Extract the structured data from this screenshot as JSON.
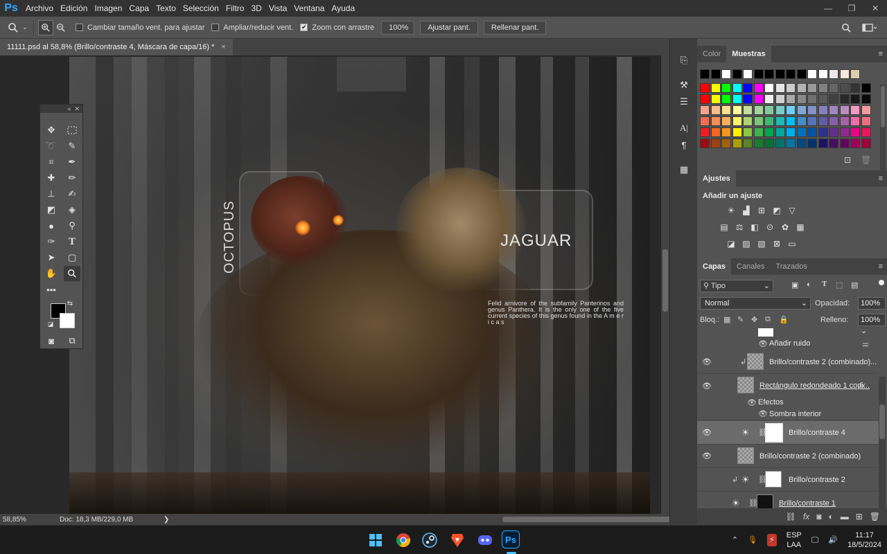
{
  "app": {
    "logo": "Ps"
  },
  "menu": [
    "Archivo",
    "Edición",
    "Imagen",
    "Capa",
    "Texto",
    "Selección",
    "Filtro",
    "3D",
    "Vista",
    "Ventana",
    "Ayuda"
  ],
  "window_controls": [
    "—",
    "❐",
    "✕"
  ],
  "options": {
    "resize_window": "Cambiar tamaño vent. para ajustar",
    "zoom_all": "Ampliar/reducir vent.",
    "scrubby_zoom": "Zoom con arrastre",
    "scrubby_zoom_checked": true,
    "zoom_value": "100%",
    "fit_screen": "Ajustar pant.",
    "fill_screen": "Rellenar pant."
  },
  "document": {
    "tab_title": "11111.psd al 58,8% (Brillo/contraste 4, Máscara de capa/16) *",
    "tab_close": "×"
  },
  "artwork": {
    "octopus_label": "OCTOPUS",
    "jaguar_label": "JAGUAR",
    "description": "Felid arnivore of the subfamily Panterinos and genus Panthera. It is the only one of the five current species of this genus found in the A m e r i c a s"
  },
  "status": {
    "zoom": "58,85%",
    "doc": "Doc: 18,3 MB/229,0 MB",
    "arrow": "❯"
  },
  "color_panel": {
    "tabs": [
      "Color",
      "Muestras"
    ],
    "active": "Muestras"
  },
  "swatch_colors": {
    "row1": [
      "#000000",
      "#000000",
      "#ffffff",
      "#000000",
      "#ffffff",
      "#000000",
      "#000000",
      "#000000",
      "#000000",
      "#000000",
      "#ffffff",
      "#ffffff",
      "#e8e8e8",
      "#f7e9d7",
      "#e0cdb0"
    ],
    "row2": [
      "#ff0000",
      "#ffff00",
      "#00ff00",
      "#00ffff",
      "#0000ff",
      "#ff00ff",
      "#ffffff",
      "#e6e6e6",
      "#cccccc",
      "#b3b3b3",
      "#999999",
      "#808080",
      "#666666",
      "#4d4d4d",
      "#333333",
      "#000000"
    ],
    "row3": [
      "#ff0000",
      "#ffff00",
      "#00ff00",
      "#00ffff",
      "#0000ff",
      "#ff00ff",
      "#f0f0f0",
      "#d0d0d0",
      "#a8a8a8",
      "#888888",
      "#707070",
      "#585858",
      "#404040",
      "#282828",
      "#181818",
      "#0a0a0a"
    ],
    "row4": [
      "#f7a38a",
      "#f9c08e",
      "#fde08e",
      "#fffb99",
      "#c4df9b",
      "#a3d39c",
      "#82ca9c",
      "#7accc8",
      "#6dcff6",
      "#7da7d9",
      "#8393ca",
      "#8781bd",
      "#a186be",
      "#bd8cbf",
      "#f49ac1",
      "#f5989d"
    ],
    "row5": [
      "#f26c4f",
      "#f68e55",
      "#fbaf5c",
      "#fff467",
      "#acd372",
      "#7cc576",
      "#3bb878",
      "#1abbb4",
      "#00bff3",
      "#438ccb",
      "#5574b9",
      "#605ca9",
      "#855fa8",
      "#a763a9",
      "#ef6ea8",
      "#f16d7e"
    ],
    "row6": [
      "#ed1c24",
      "#f26522",
      "#f7941d",
      "#fff200",
      "#8dc63f",
      "#39b54a",
      "#00a651",
      "#00a99d",
      "#00aeef",
      "#0072bc",
      "#0054a5",
      "#2e3192",
      "#662d91",
      "#92278f",
      "#ec008c",
      "#ed145b"
    ],
    "row7": [
      "#9e0b0f",
      "#a0410d",
      "#a3620a",
      "#aba000",
      "#598527",
      "#197b30",
      "#007236",
      "#00746b",
      "#0076a3",
      "#004a80",
      "#003471",
      "#1b1464",
      "#440e62",
      "#630460",
      "#9e005d",
      "#9e0039"
    ]
  },
  "adjust_panel": {
    "tab": "Ajustes",
    "title": "Añadir un ajuste"
  },
  "layers_panel": {
    "tabs": [
      "Capas",
      "Canales",
      "Trazados"
    ],
    "filter": "Tipo",
    "blend_mode": "Normal",
    "opacity_label": "Opacidad:",
    "opacity": "100%",
    "lock_label": "Bloq.:",
    "fill_label": "Relleno:",
    "fill": "100%",
    "layers": [
      {
        "name": "Añadir ruido",
        "kind": "filter"
      },
      {
        "name": "Brillo/contraste 2 (combinado)...",
        "kind": "layer"
      },
      {
        "name": "Rectángulo redondeado 1 copi...",
        "kind": "shape",
        "fx": "fx"
      },
      {
        "name": "Efectos",
        "kind": "effects"
      },
      {
        "name": "Sombra interior",
        "kind": "effect"
      },
      {
        "name": "Brillo/contraste 4",
        "kind": "adjust",
        "selected": true
      },
      {
        "name": "Brillo/contraste 2 (combinado)",
        "kind": "layer"
      },
      {
        "name": "Brillo/contraste 2",
        "kind": "adjust"
      },
      {
        "name": "Brillo/contraste 1",
        "kind": "adjust"
      }
    ]
  },
  "taskbar": {
    "lang": "ESP",
    "lang2": "LAA",
    "time": "11:17",
    "date": "18/5/2024",
    "ps_label": "Ps"
  }
}
